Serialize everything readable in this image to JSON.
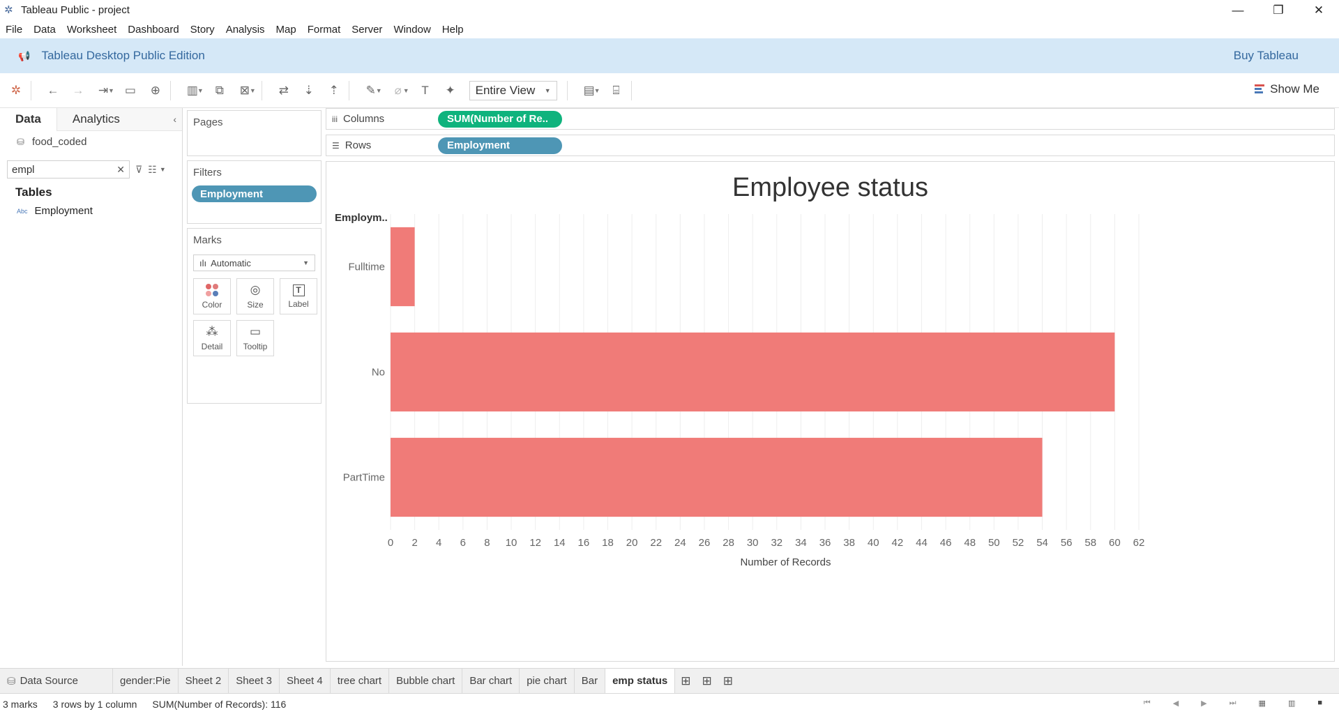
{
  "window": {
    "title": "Tableau Public - project",
    "controls": [
      "—",
      "❐",
      "✕"
    ]
  },
  "menu": [
    "File",
    "Data",
    "Worksheet",
    "Dashboard",
    "Story",
    "Analysis",
    "Map",
    "Format",
    "Server",
    "Window",
    "Help"
  ],
  "banner": {
    "edition": "Tableau Desktop Public Edition",
    "buy": "Buy Tableau",
    "color": "#d5e8f7"
  },
  "toolbar": {
    "view_mode": "Entire View",
    "show_me": "Show Me"
  },
  "data_pane": {
    "tab_data": "Data",
    "tab_analytics": "Analytics",
    "datasource": "food_coded",
    "search_value": "empl",
    "tables_heading": "Tables",
    "field_type": "Abc",
    "field_name": "Employment"
  },
  "cards": {
    "pages": "Pages",
    "filters": "Filters",
    "filter_pill": "Employment",
    "marks": "Marks",
    "mark_type": "Automatic",
    "buttons": {
      "color": "Color",
      "size": "Size",
      "label": "Label",
      "detail": "Detail",
      "tooltip": "Tooltip"
    }
  },
  "shelves": {
    "columns_label": "Columns",
    "columns_pill": "SUM(Number of Re..",
    "rows_label": "Rows",
    "rows_pill": "Employment"
  },
  "chart_data": {
    "type": "bar",
    "orientation": "horizontal",
    "title": "Employee status",
    "row_header": "Employm..",
    "categories": [
      "Fulltime",
      "No",
      "PartTime"
    ],
    "values": [
      2,
      60,
      54
    ],
    "xlabel": "Number of Records",
    "xlim": [
      0,
      62
    ],
    "xticks": [
      0,
      2,
      4,
      6,
      8,
      10,
      12,
      14,
      16,
      18,
      20,
      22,
      24,
      26,
      28,
      30,
      32,
      34,
      36,
      38,
      40,
      42,
      44,
      46,
      48,
      50,
      52,
      54,
      56,
      58,
      60,
      62
    ],
    "bar_color": "#f07b78",
    "grid": "vertical"
  },
  "sheet_tabs": {
    "data_source": "Data Source",
    "sheets": [
      "gender:Pie",
      "Sheet 2",
      "Sheet 3",
      "Sheet 4",
      "tree chart",
      "Bubble chart",
      "Bar chart",
      "pie chart",
      "Bar",
      "emp status"
    ],
    "active": "emp status"
  },
  "status": {
    "marks": "3 marks",
    "dims": "3 rows by 1 column",
    "sum": "SUM(Number of Records): 116"
  }
}
